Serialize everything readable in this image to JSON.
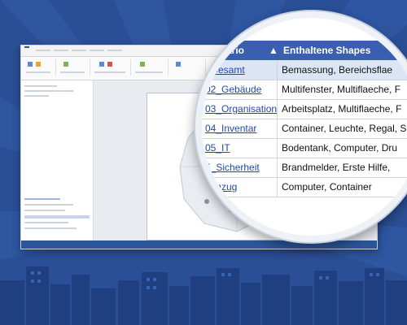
{
  "header": {
    "col1_partial": "ario",
    "col2": "Enthaltene Shapes"
  },
  "rows": [
    {
      "link": "_Gesamt",
      "shapes": "Bemassung, Bereichsflae"
    },
    {
      "link": "02_Gebäude",
      "shapes": "Multifenster, Multiflaeche, F"
    },
    {
      "link": "03_Organisation",
      "shapes": "Arbeitsplatz, Multiflaeche, F"
    },
    {
      "link": "04_Inventar",
      "shapes": "Container, Leuchte, Regal, S"
    },
    {
      "link": "05_IT",
      "shapes": "Bodentank, Computer, Dru"
    },
    {
      "link": "5_Sicherheit",
      "shapes": "Brandmelder, Erste Hilfe,"
    },
    {
      "link": "mzug",
      "shapes": "Computer, Container"
    }
  ],
  "colors": {
    "background": "#2b4f96",
    "header": "#3a5fb0",
    "link": "#1f49a8",
    "selected_row": "#dbe5f5",
    "ribbon_accent": "#2b579a"
  },
  "icons": [
    "city-skyline",
    "magnifier-lens",
    "map-pin-icon"
  ]
}
